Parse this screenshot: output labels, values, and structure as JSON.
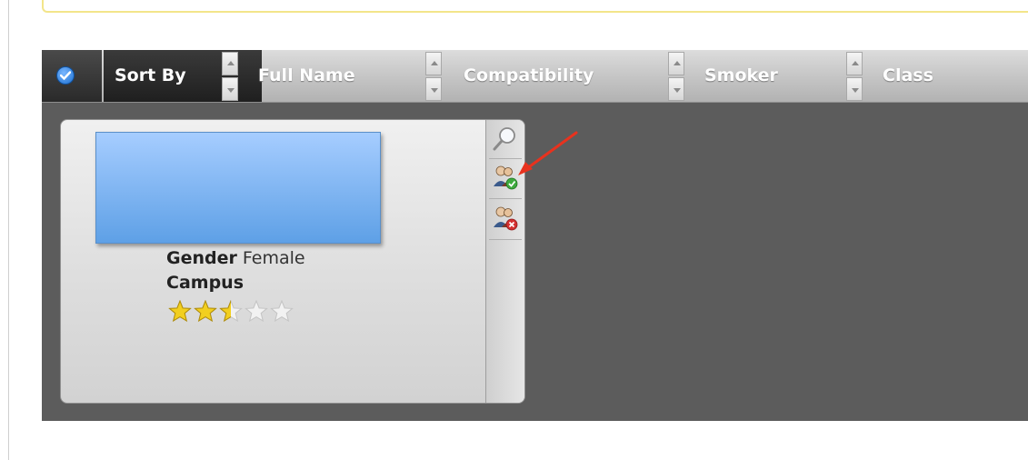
{
  "sort_bar": {
    "select_all_icon": "check-circle-icon",
    "sort_by_label": "Sort By",
    "columns": [
      {
        "label": "Full Name"
      },
      {
        "label": "Compatibility"
      },
      {
        "label": "Smoker"
      },
      {
        "label": "Class"
      }
    ]
  },
  "card": {
    "gender_label": "Gender",
    "gender_value": "Female",
    "campus_label": "Campus",
    "campus_value": "",
    "rating": 2.5,
    "rating_max": 5,
    "actions": [
      {
        "icon": "magnifier-icon"
      },
      {
        "icon": "accept-roommate-icon"
      },
      {
        "icon": "reject-roommate-icon"
      }
    ]
  },
  "annotation": {
    "icon": "red-arrow-icon",
    "color": "#e8321e"
  },
  "colors": {
    "accent": "#1b6fd0",
    "panel": "#5c5c5c",
    "bar": "#c6c6c6"
  }
}
